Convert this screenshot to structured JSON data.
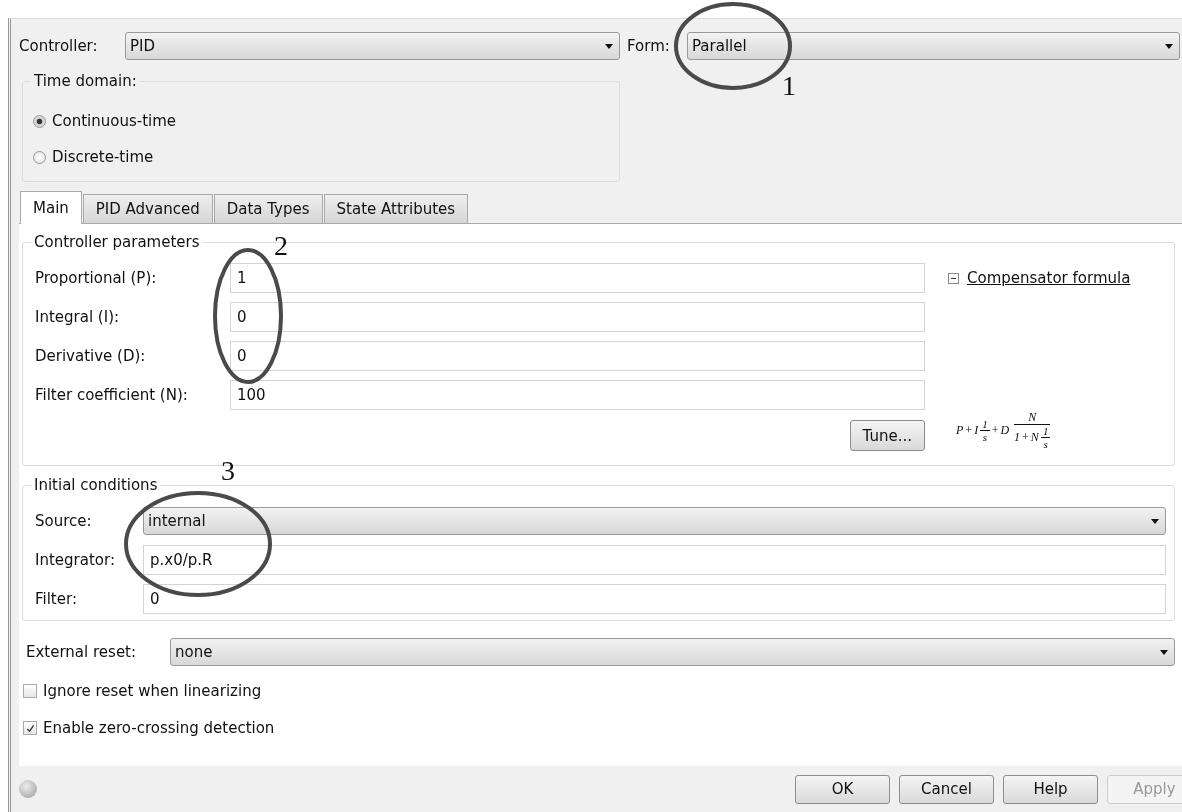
{
  "controller": {
    "label": "Controller:",
    "value": "PID"
  },
  "form": {
    "label": "Form:",
    "value": "Parallel"
  },
  "time_domain": {
    "title": "Time domain:",
    "options": [
      {
        "label": "Continuous-time",
        "selected": true
      },
      {
        "label": "Discrete-time",
        "selected": false
      }
    ]
  },
  "tabs": [
    {
      "label": "Main",
      "selected": true
    },
    {
      "label": "PID Advanced",
      "selected": false
    },
    {
      "label": "Data Types",
      "selected": false
    },
    {
      "label": "State Attributes",
      "selected": false
    }
  ],
  "controller_parameters": {
    "title": "Controller parameters",
    "fields": [
      {
        "label": "Proportional (P):",
        "value": "1"
      },
      {
        "label": "Integral (I):",
        "value": "0"
      },
      {
        "label": "Derivative (D):",
        "value": "0"
      },
      {
        "label": "Filter coefficient (N):",
        "value": "100"
      }
    ],
    "tune_button": "Tune...",
    "formula_toggle": {
      "label": "Compensator formula",
      "expanded": true
    },
    "formula": {
      "p": "P",
      "plus1": "+",
      "i": "I",
      "f1_num": "1",
      "f1_den": "s",
      "plus2": "+",
      "d": "D",
      "num": "N",
      "den_one": "1",
      "den_plus": "+",
      "den_n": "N",
      "f2_num": "1",
      "f2_den": "s"
    }
  },
  "initial_conditions": {
    "title": "Initial conditions",
    "source": {
      "label": "Source:",
      "value": "internal"
    },
    "fields": [
      {
        "label": "Integrator:",
        "value": "p.x0/p.R"
      },
      {
        "label": "Filter:",
        "value": "0"
      }
    ]
  },
  "external_reset": {
    "label": "External reset:",
    "value": "none"
  },
  "checkboxes": [
    {
      "label": "Ignore reset when linearizing",
      "checked": false
    },
    {
      "label": "Enable zero-crossing detection",
      "checked": true
    }
  ],
  "buttons": [
    {
      "label": "OK",
      "disabled": false
    },
    {
      "label": "Cancel",
      "disabled": false
    },
    {
      "label": "Help",
      "disabled": false
    },
    {
      "label": "Apply",
      "disabled": true
    }
  ],
  "annotations": [
    {
      "label": "1"
    },
    {
      "label": "2"
    },
    {
      "label": "3"
    }
  ]
}
